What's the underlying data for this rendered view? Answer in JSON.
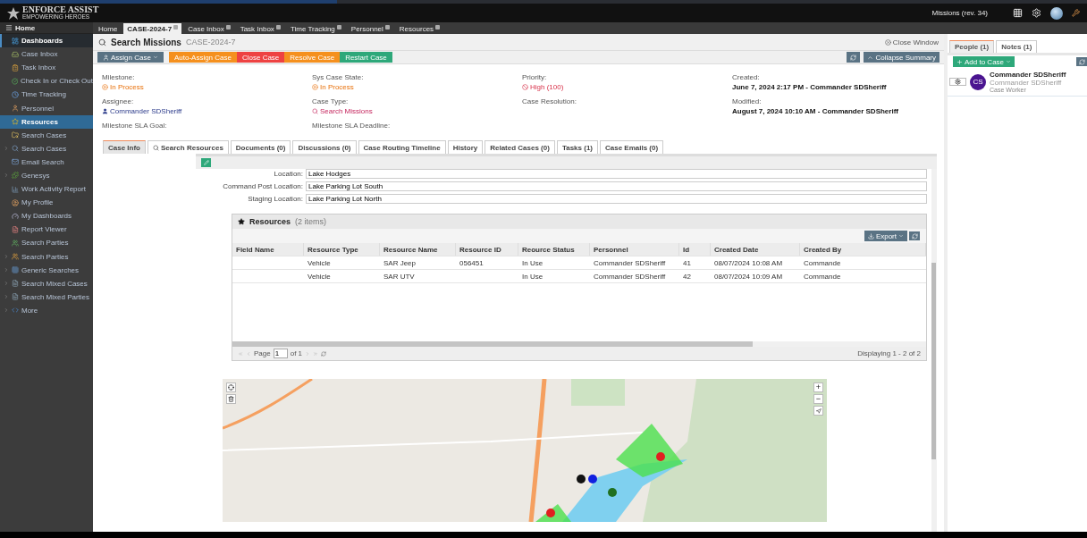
{
  "app": {
    "logo_title": "ENFORCE ASSIST",
    "logo_tagline": "EMPOWERING HEROES",
    "context": "Missions (rev. 34)"
  },
  "top_tabs": [
    {
      "label": "Home",
      "selected": false,
      "closable": false
    },
    {
      "label": "CASE-2024-7",
      "selected": true,
      "closable": true
    },
    {
      "label": "Case Inbox",
      "selected": false,
      "closable": true
    },
    {
      "label": "Task Inbox",
      "selected": false,
      "closable": true
    },
    {
      "label": "Time Tracking",
      "selected": false,
      "closable": true
    },
    {
      "label": "Personnel",
      "selected": false,
      "closable": true
    },
    {
      "label": "Resources",
      "selected": false,
      "closable": true
    }
  ],
  "sidebar": {
    "home": "Home",
    "items": [
      {
        "label": "Dashboards",
        "selected": false,
        "highlighted": true,
        "kind": "link"
      },
      {
        "label": "Case Inbox",
        "selected": false,
        "highlighted": false,
        "kind": "link"
      },
      {
        "label": "Task Inbox",
        "selected": false,
        "highlighted": false,
        "kind": "link"
      },
      {
        "label": "Check In or Check Out",
        "selected": false,
        "highlighted": false,
        "kind": "link"
      },
      {
        "label": "Time Tracking",
        "selected": false,
        "highlighted": false,
        "kind": "link"
      },
      {
        "label": "Personnel",
        "selected": false,
        "highlighted": false,
        "kind": "link"
      },
      {
        "label": "Resources",
        "selected": true,
        "highlighted": false,
        "kind": "link"
      },
      {
        "label": "Search Cases",
        "selected": false,
        "highlighted": false,
        "kind": "link"
      },
      {
        "label": "Search Cases",
        "selected": false,
        "highlighted": false,
        "kind": "group"
      },
      {
        "label": "Email Search",
        "selected": false,
        "highlighted": false,
        "kind": "link"
      },
      {
        "label": "Genesys",
        "selected": false,
        "highlighted": false,
        "kind": "group"
      },
      {
        "label": "Work Activity Report",
        "selected": false,
        "highlighted": false,
        "kind": "link"
      },
      {
        "label": "My Profile",
        "selected": false,
        "highlighted": false,
        "kind": "link"
      },
      {
        "label": "My Dashboards",
        "selected": false,
        "highlighted": false,
        "kind": "link"
      },
      {
        "label": "Report Viewer",
        "selected": false,
        "highlighted": false,
        "kind": "link"
      },
      {
        "label": "Search Parties",
        "selected": false,
        "highlighted": false,
        "kind": "link"
      },
      {
        "label": "Search Parties",
        "selected": false,
        "highlighted": false,
        "kind": "group"
      },
      {
        "label": "Generic Searches",
        "selected": false,
        "highlighted": false,
        "kind": "group"
      },
      {
        "label": "Search Mixed Cases",
        "selected": false,
        "highlighted": false,
        "kind": "group"
      },
      {
        "label": "Search Mixed Parties",
        "selected": false,
        "highlighted": false,
        "kind": "group"
      },
      {
        "label": "More",
        "selected": false,
        "highlighted": false,
        "kind": "group"
      }
    ]
  },
  "case": {
    "title": "Search Missions",
    "id": "CASE-2024-7",
    "close_window": "Close Window",
    "actions": [
      {
        "label": "Assign Case",
        "kind": "dropdown",
        "color": "#5a7384"
      },
      {
        "label": "Auto-Assign Case",
        "kind": "plain",
        "color": "#f5901e"
      },
      {
        "label": "Close Case",
        "kind": "plain",
        "color": "#ee4242"
      },
      {
        "label": "Resolve Case",
        "kind": "plain",
        "color": "#f5901e"
      },
      {
        "label": "Restart Case",
        "kind": "plain",
        "color": "#2ea87a"
      }
    ],
    "collapse_summary": "Collapse Summary",
    "summary": [
      {
        "label": "Milestone:",
        "value": "In Process",
        "kind": "process"
      },
      {
        "label": "Sys Case State:",
        "value": "In Process",
        "kind": "process"
      },
      {
        "label": "Priority:",
        "value": "High (100)",
        "kind": "priority"
      },
      {
        "label": "Created:",
        "value": "June 7, 2024 2:17 PM - Commander SDSheriff",
        "kind": "bold"
      },
      {
        "label": "Assignee:",
        "value": "Commander SDSheriff",
        "kind": "user"
      },
      {
        "label": "Case Type:",
        "value": "Search Missions",
        "kind": "search"
      },
      {
        "label": "Case Resolution:",
        "kind": "empty"
      },
      {
        "label": "Modified:",
        "value": "August 7, 2024 10:10 AM - Commander SDSheriff",
        "kind": "bold"
      },
      {
        "label": "Milestone SLA Goal:",
        "kind": "empty"
      },
      {
        "label": "Milestone SLA Deadline:",
        "kind": "empty"
      }
    ]
  },
  "case_tabs": [
    {
      "label": "Case Info",
      "selected": true
    },
    {
      "label": "Search Resources",
      "selected": false
    },
    {
      "label": "Documents (0)",
      "selected": false
    },
    {
      "label": "Discussions (0)",
      "selected": false
    },
    {
      "label": "Case Routing Timeline",
      "selected": false
    },
    {
      "label": "History",
      "selected": false
    },
    {
      "label": "Related Cases (0)",
      "selected": false
    },
    {
      "label": "Tasks (1)",
      "selected": false
    },
    {
      "label": "Case Emails (0)",
      "selected": false
    }
  ],
  "fields": [
    {
      "label": "Location:",
      "value": "Lake Hodges"
    },
    {
      "label": "Command Post Location:",
      "value": "Lake Parking Lot South"
    },
    {
      "label": "Staging Location:",
      "value": "Lake Parking Lot North"
    }
  ],
  "resources": {
    "title": "Resources",
    "count": "(2 items)",
    "export": "Export",
    "columns": [
      "Field Name",
      "Resource Type",
      "Resource Name",
      "Resource ID",
      "Reource Status",
      "Personnel",
      "Id",
      "Created Date",
      "Created By"
    ],
    "rows": [
      [
        "",
        "Vehicle",
        "SAR Jeep",
        "056451",
        "In Use",
        "Commander SDSheriff",
        "41",
        "08/07/2024 10:08 AM",
        "Commande"
      ],
      [
        "",
        "Vehicle",
        "SAR UTV",
        "",
        "In Use",
        "Commander SDSheriff",
        "42",
        "08/07/2024 10:09 AM",
        "Commande"
      ]
    ],
    "pager": {
      "page_label": "Page",
      "page": "1",
      "of": "of 1",
      "displaying": "Displaying 1 - 2 of 2"
    }
  },
  "map": {
    "zoom_in": "+",
    "zoom_out": "−"
  },
  "people_panel": {
    "tabs": [
      {
        "label": "People (1)",
        "selected": true
      },
      {
        "label": "Notes (1)",
        "selected": false
      }
    ],
    "add": "Add to Case",
    "people": [
      {
        "initials": "CS",
        "name": "Commander SDSheriff",
        "subtitle": "Commander SDSheriff",
        "role": "Case Worker"
      }
    ]
  }
}
